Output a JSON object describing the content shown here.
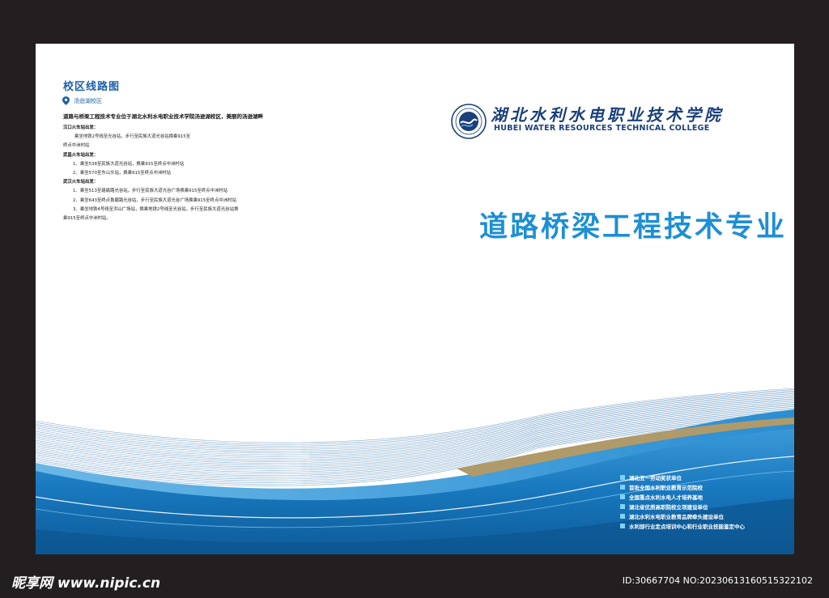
{
  "route": {
    "title": "校区线路图",
    "campus": "汤逊湖校区",
    "intro": "道路与桥梁工程技术专业位于湖北水利水电职业技术学院汤逊湖校区，美丽的汤逊湖畔",
    "lines": [
      {
        "text": "汉口火车站出发：",
        "style": "head"
      },
      {
        "text": "乘坐地铁2号线至光谷站，步行至民族大道光谷站换乘915至",
        "style": "indent1"
      },
      {
        "text": "终点中洲村站",
        "style": "plain"
      },
      {
        "text": "武昌火车站出发：",
        "style": "head"
      },
      {
        "text": "1、乘坐538至民族大道光谷站，换乘915至终点中洲村站",
        "style": "indent2"
      },
      {
        "text": "2、乘坐570至东山头站，换乘915至终点中洲村站",
        "style": "indent2"
      },
      {
        "text": "武汉火车站出发：",
        "style": "head"
      },
      {
        "text": "1、乘坐513至珞瑜路光谷站，步行至民族大道光谷广场换乘915至终点中洲村站",
        "style": "indent2"
      },
      {
        "text": "2、乘坐643至终点鲁磨路光谷站，步行至民族大道光谷广场换乘915至终点中洲村站",
        "style": "indent2"
      },
      {
        "text": "3、乘坐地铁4号线至洪山广场站，换乘地铁2号线至光谷站，步行至民族大道光谷站换",
        "style": "indent2"
      },
      {
        "text": "乘915至终点中洲村站。",
        "style": "plain"
      }
    ]
  },
  "college": {
    "name_cn": "湖北水利水电职业技术学院",
    "name_en": "HUBEI WATER RESOURCES TECHNICAL COLLEGE",
    "logo_icon": "college-seal-icon"
  },
  "major_title": "道路桥梁工程技术专业",
  "honors": [
    "湖北五一劳动奖状单位",
    "首批全国水利职业教育示范院校",
    "全国重点水利水电人才培养基地",
    "湖北省优质高职院校立项建设单位",
    "湖北水利水电职业教育品牌牵头建设单位",
    "水利部行业定点培训中心和行业职业技能鉴定中心"
  ],
  "watermark": {
    "site": "昵享网 www.nipic.cn",
    "id": "ID:30667704 NO:20230613160515322102"
  },
  "colors": {
    "title_blue": "#1d8fd4",
    "navy": "#1a3f7a",
    "wave_dark": "#0d5b97",
    "wave_mid": "#2a8fd0",
    "gold": "#b09a6a",
    "frame": "#231f20"
  }
}
